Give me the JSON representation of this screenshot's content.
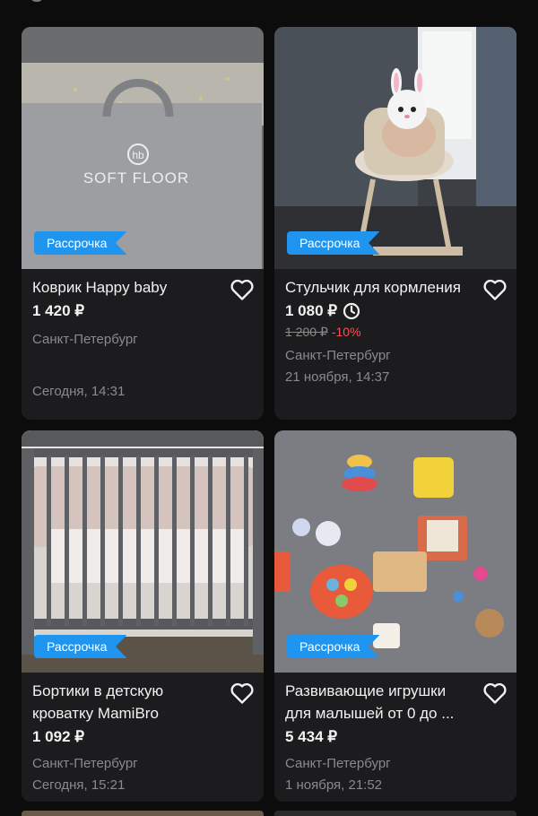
{
  "listings": [
    {
      "title": "Коврик Happy baby",
      "price": "1 420 ₽",
      "city": "Санкт-Петербург",
      "date": "Сегодня, 14:31",
      "badge": "Рассрочка",
      "photo_text": "SOFT FLOOR",
      "photo_logo": "hb"
    },
    {
      "title": "Стульчик для кормления",
      "price": "1 080 ₽",
      "old_price": "1 200 ₽",
      "discount": "-10%",
      "city": "Санкт-Петербург",
      "date": "21 ноября, 14:37",
      "badge": "Рассрочка"
    },
    {
      "title": "Бортики в детскую кроватку MamiBro",
      "price": "1 092 ₽",
      "city": "Санкт-Петербург",
      "date": "Сегодня, 15:21",
      "badge": "Рассрочка"
    },
    {
      "title": "Развивающие игрушки для малышей от 0 до ...",
      "price": "5 434 ₽",
      "city": "Санкт-Петербург",
      "date": "1 ноября, 21:52",
      "badge": "Рассрочка"
    }
  ],
  "colors": {
    "background": "#0c0c0c",
    "card": "#1c1c1e",
    "badge": "#1f95f0",
    "discount": "#ff4d4f",
    "muted_text": "#8a8a8f"
  },
  "icons": [
    "heart-outline-icon",
    "clock-icon"
  ]
}
